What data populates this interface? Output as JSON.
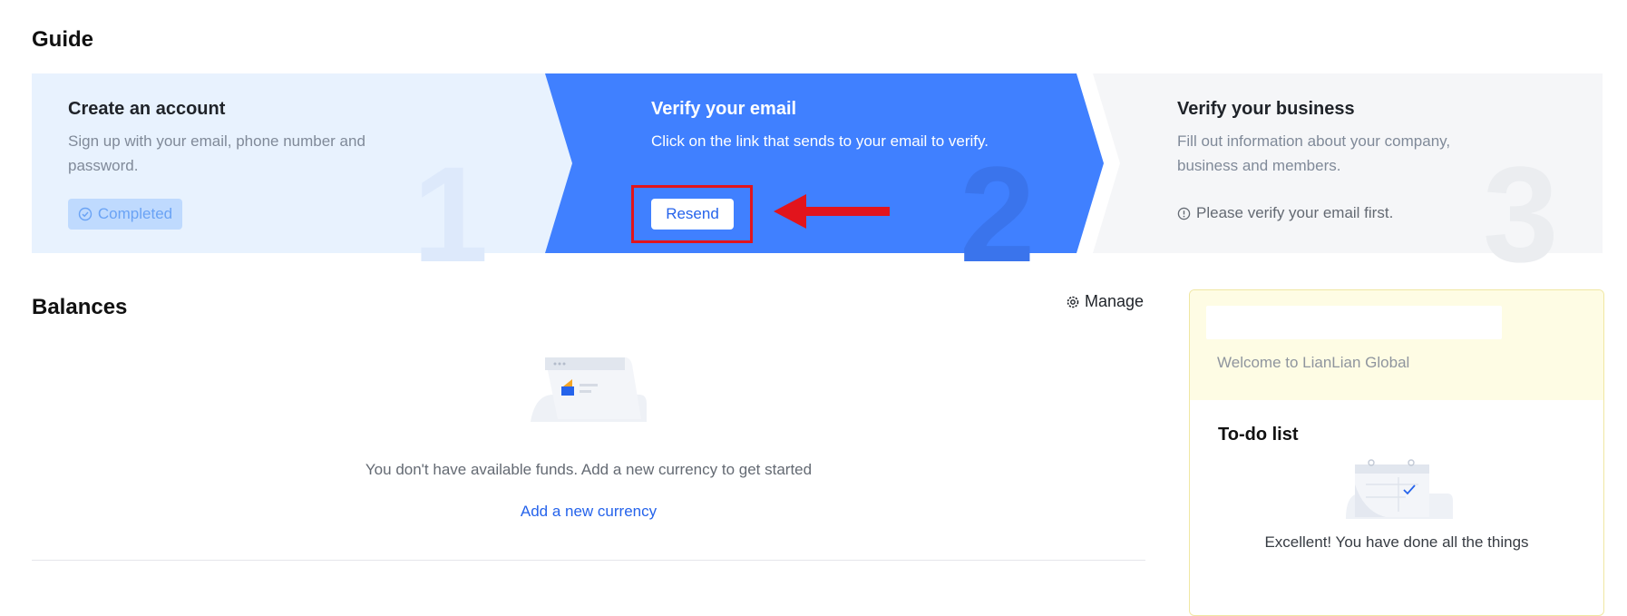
{
  "guide": {
    "title": "Guide",
    "steps": [
      {
        "number": "1",
        "title": "Create an account",
        "description": "Sign up with your email, phone number and password.",
        "status_label": "Completed"
      },
      {
        "number": "2",
        "title": "Verify your email",
        "description": "Click on the link that sends to your email to verify.",
        "action_label": "Resend"
      },
      {
        "number": "3",
        "title": "Verify your business",
        "description": "Fill out information about your company, business and members.",
        "note": "Please verify your email first."
      }
    ]
  },
  "balances": {
    "title": "Balances",
    "manage_label": "Manage",
    "empty_text": "You don't have available funds. Add a new currency to get started",
    "add_currency_label": "Add a new currency"
  },
  "side_panel": {
    "welcome_text": "Welcome to LianLian Global",
    "todo_title": "To-do list",
    "todo_empty_text": "Excellent! You have done all the things"
  },
  "colors": {
    "accent": "#4080ff",
    "step_completed_bg": "#e8f2fe",
    "step_pending_bg": "#f5f6f8",
    "annotation_red": "#e2141c",
    "link": "#2563eb",
    "welcome_bg": "#fefce4"
  },
  "icons": {
    "completed": "check-circle-icon",
    "note": "info-circle-icon",
    "manage": "gear-icon",
    "annotation": "red-arrow-icon"
  }
}
